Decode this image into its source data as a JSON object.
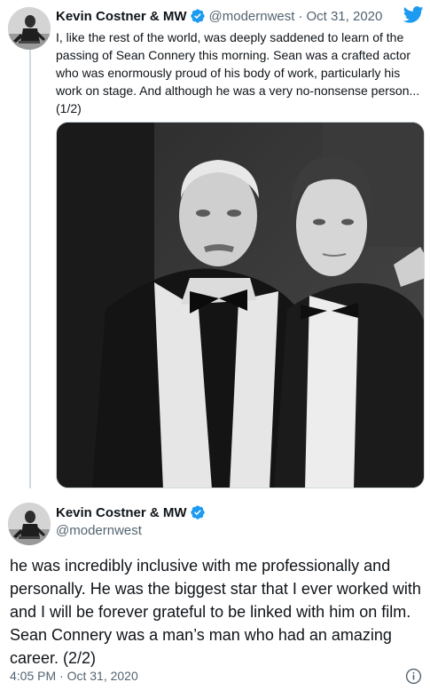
{
  "tweet1": {
    "author_name": "Kevin Costner & MW",
    "handle": "@modernwest",
    "separator": "·",
    "date": "Oct 31, 2020",
    "text": "I, like the rest of the world, was deeply saddened to learn of the passing of Sean Connery this morning. Sean was a crafted actor who was enormously proud of his body of work, particularly his work on stage. And although he was a very no-nonsense person... (1/2)",
    "photo_icon": "black-and-white-photo"
  },
  "tweet2": {
    "author_name": "Kevin Costner & MW",
    "handle": "@modernwest",
    "text": "he was incredibly inclusive with me professionally and personally. He was the biggest star that I ever worked with and I will be forever grateful to be linked with him on film. Sean Connery was a man’s man who had an amazing career. (2/2)",
    "timestamp": "4:05 PM · Oct 31, 2020"
  },
  "icons": {
    "verified": "verified-badge-icon",
    "twitter": "twitter-bird-icon",
    "info": "info-icon"
  },
  "colors": {
    "twitter_blue": "#1d9bf0",
    "muted_text": "#536471",
    "text": "#0f1419"
  }
}
